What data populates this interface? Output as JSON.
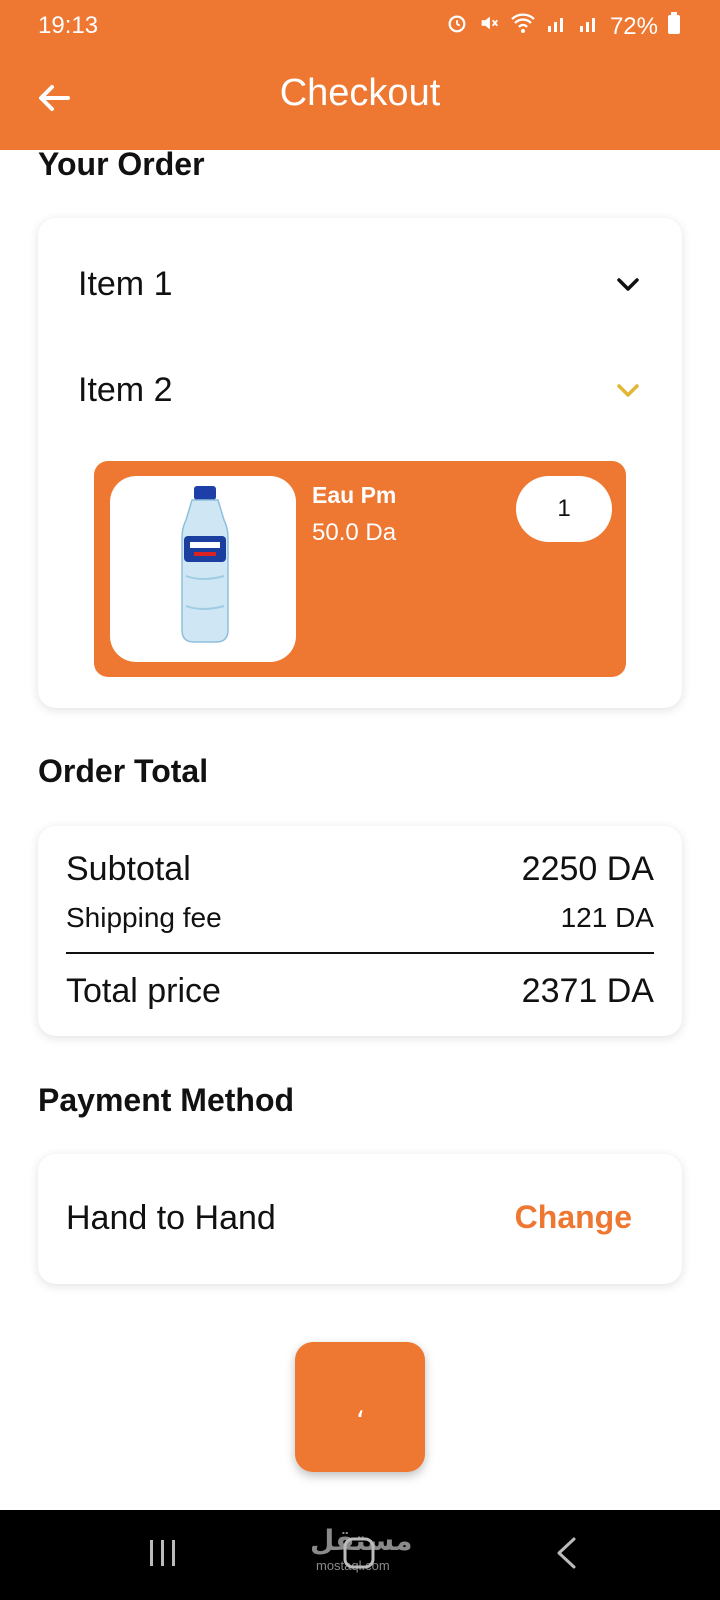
{
  "status_bar": {
    "time": "19:13",
    "battery": "72%"
  },
  "header": {
    "title": "Checkout"
  },
  "order": {
    "section_title": "Your Order",
    "items": [
      {
        "label": "Item 1",
        "expanded": false
      },
      {
        "label": "Item 2",
        "expanded": true
      }
    ],
    "product": {
      "name": "Eau Pm",
      "price": "50.0 Da",
      "quantity": "1"
    }
  },
  "totals": {
    "section_title": "Order Total",
    "subtotal_label": "Subtotal",
    "subtotal_value": "2250 DA",
    "shipping_label": "Shipping fee",
    "shipping_value": "121 DA",
    "total_label": "Total price",
    "total_value": "2371 DA"
  },
  "payment": {
    "section_title": "Payment Method",
    "method": "Hand to Hand",
    "change_label": "Change"
  },
  "action_button": {
    "label": "،"
  },
  "watermark": {
    "text": "مستقل",
    "sub": "mostaql.com"
  },
  "colors": {
    "accent": "#EE7731",
    "chevron_active": "#E2B632"
  }
}
